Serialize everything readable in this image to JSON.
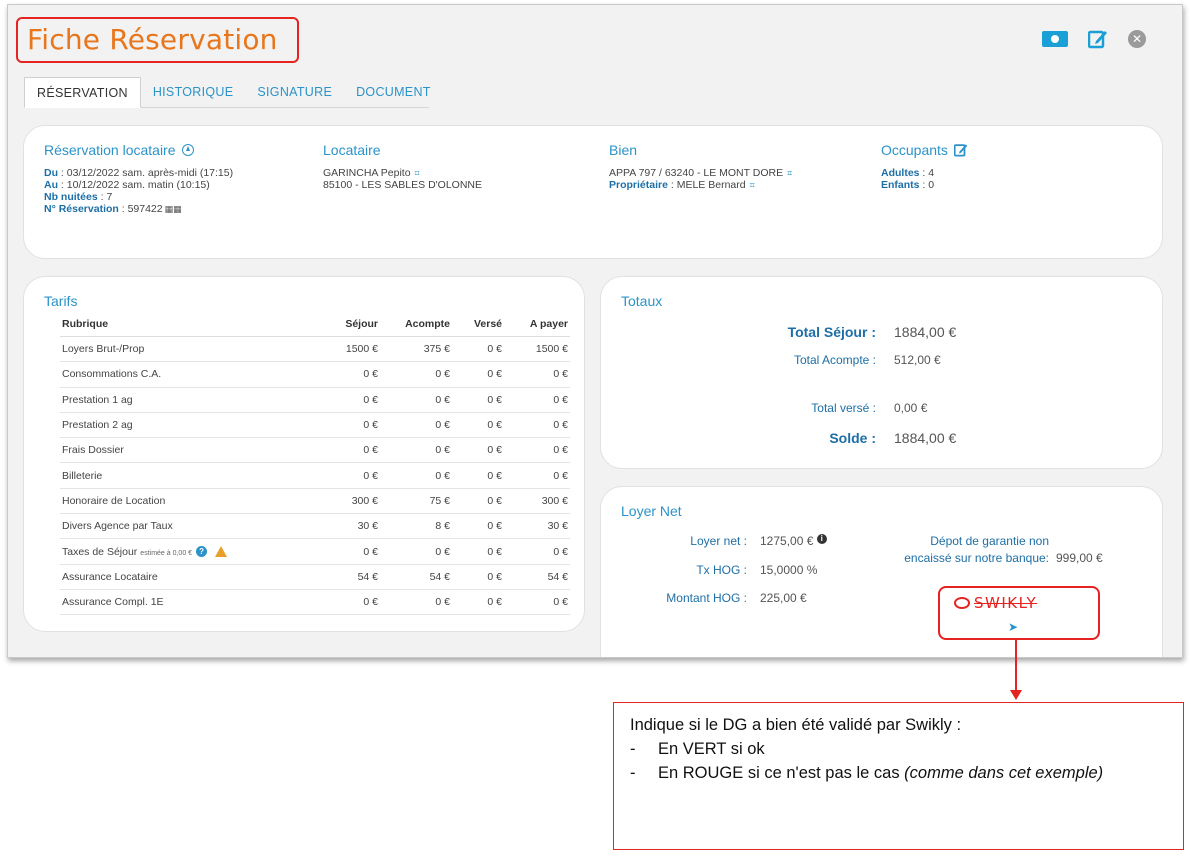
{
  "title": "Fiche Réservation",
  "top_icons": [
    "cash-icon",
    "edit-icon",
    "close-icon"
  ],
  "tabs": [
    {
      "label": "RÉSERVATION",
      "active": true
    },
    {
      "label": "HISTORIQUE"
    },
    {
      "label": "SIGNATURE"
    },
    {
      "label": "DOCUMENT"
    }
  ],
  "reservation": {
    "title": "Réservation locataire",
    "du_label": "Du",
    "du_value": "03/12/2022 sam. après-midi (17:15)",
    "au_label": "Au",
    "au_value": "10/12/2022 sam. matin (10:15)",
    "nuitees_label": "Nb nuitées",
    "nuitees_value": "7",
    "numero_label": "N° Réservation",
    "numero_value": "597422"
  },
  "locataire": {
    "title": "Locataire",
    "name": "GARINCHA Pepito",
    "address": "85100 - LES SABLES D'OLONNE"
  },
  "bien": {
    "title": "Bien",
    "name": "APPA 797 / 63240 - LE MONT DORE",
    "proprietaire_label": "Propriétaire",
    "proprietaire_value": "MELE Bernard"
  },
  "occupants": {
    "title": "Occupants",
    "adultes_label": "Adultes",
    "adultes_value": "4",
    "enfants_label": "Enfants",
    "enfants_value": "0"
  },
  "tarifs": {
    "title": "Tarifs",
    "headers": [
      "Rubrique",
      "Séjour",
      "Acompte",
      "Versé",
      "A payer"
    ],
    "rows": [
      [
        "Loyers Brut-/Prop",
        "1500 €",
        "375 €",
        "0 €",
        "1500 €"
      ],
      [
        "Consommations C.A.",
        "0 €",
        "0 €",
        "0 €",
        "0 €"
      ],
      [
        "Prestation 1 ag",
        "0 €",
        "0 €",
        "0 €",
        "0 €"
      ],
      [
        "Prestation 2 ag",
        "0 €",
        "0 €",
        "0 €",
        "0 €"
      ],
      [
        "Frais Dossier",
        "0 €",
        "0 €",
        "0 €",
        "0 €"
      ],
      [
        "Billeterie",
        "0 €",
        "0 €",
        "0 €",
        "0 €"
      ],
      [
        "Honoraire de Location",
        "300 €",
        "75 €",
        "0 €",
        "300 €"
      ],
      [
        "Divers Agence par Taux",
        "30 €",
        "8 €",
        "0 €",
        "30 €"
      ],
      [
        "Taxes de Séjour",
        "0 €",
        "0 €",
        "0 €",
        "0 €"
      ],
      [
        "Assurance Locataire",
        "54 €",
        "54 €",
        "0 €",
        "54 €"
      ],
      [
        "Assurance Compl. 1E",
        "0 €",
        "0 €",
        "0 €",
        "0 €"
      ]
    ],
    "taxes_estimate": "estimée à 0,00 €"
  },
  "totaux": {
    "title": "Totaux",
    "sejour_label": "Total Séjour :",
    "sejour_value": "1884,00 €",
    "acompte_label": "Total Acompte :",
    "acompte_value": "512,00 €",
    "verse_label": "Total versé :",
    "verse_value": "0,00 €",
    "solde_label": "Solde :",
    "solde_value": "1884,00 €"
  },
  "loyer_net": {
    "title": "Loyer Net",
    "net_label": "Loyer net :",
    "net_value": "1275,00 €",
    "tx_label": "Tx HOG :",
    "tx_value": "15,0000 %",
    "montant_label": "Montant HOG :",
    "montant_value": "225,00 €",
    "depot_label": "Dépot de garantie non encaissé sur notre banque:",
    "depot_value": "999,00 €",
    "swikly_logo": "SWIKLY",
    "swikly_status_color": "#e52320"
  },
  "note": {
    "title": "Indique si le DG a bien été validé par Swikly :",
    "item1": "En VERT si ok",
    "item2_text": "En ROUGE si ce n'est pas le cas ",
    "item2_italic": "(comme dans cet exemple)"
  }
}
